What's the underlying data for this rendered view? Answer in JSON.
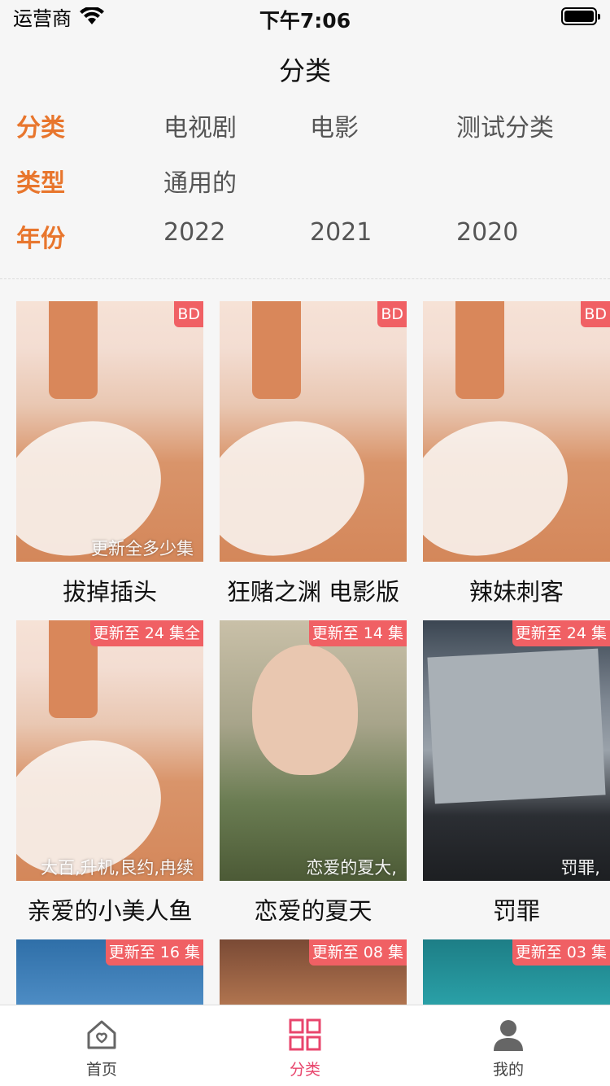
{
  "status_bar": {
    "carrier": "运营商",
    "time": "下午7:06"
  },
  "nav": {
    "title": "分类"
  },
  "filters": [
    {
      "label": "分类",
      "options": [
        "电视剧",
        "电影",
        "测试分类"
      ]
    },
    {
      "label": "类型",
      "options": [
        "通用的"
      ]
    },
    {
      "label": "年份",
      "options": [
        "2022",
        "2021",
        "2020"
      ]
    }
  ],
  "items": [
    {
      "title": "拔掉插头",
      "badge": "BD",
      "caption": "更新全多少集"
    },
    {
      "title": "狂赌之渊 电影版",
      "badge": "BD",
      "caption": ""
    },
    {
      "title": "辣妹刺客",
      "badge": "BD",
      "caption": ""
    },
    {
      "title": "亲爱的小美人鱼",
      "badge": "更新至 24 集全",
      "caption": "大百,升机,艮约,冉续"
    },
    {
      "title": "恋爱的夏天",
      "badge": "更新至 14 集",
      "caption": "恋爱的夏大,"
    },
    {
      "title": "罚罪",
      "badge": "更新至 24 集",
      "caption": "罚罪,"
    },
    {
      "title": "",
      "badge": "更新至 16 集",
      "caption": ""
    },
    {
      "title": "",
      "badge": "更新至 08 集",
      "caption": ""
    },
    {
      "title": "",
      "badge": "更新至 03 集",
      "caption": ""
    }
  ],
  "tab_bar": {
    "tabs": [
      {
        "label": "首页",
        "icon": "home-icon"
      },
      {
        "label": "分类",
        "icon": "grid-icon",
        "active": true
      },
      {
        "label": "我的",
        "icon": "user-icon"
      }
    ]
  },
  "colors": {
    "accent": "#e8762d",
    "badge": "#f06064",
    "tab_active": "#e8456c"
  }
}
